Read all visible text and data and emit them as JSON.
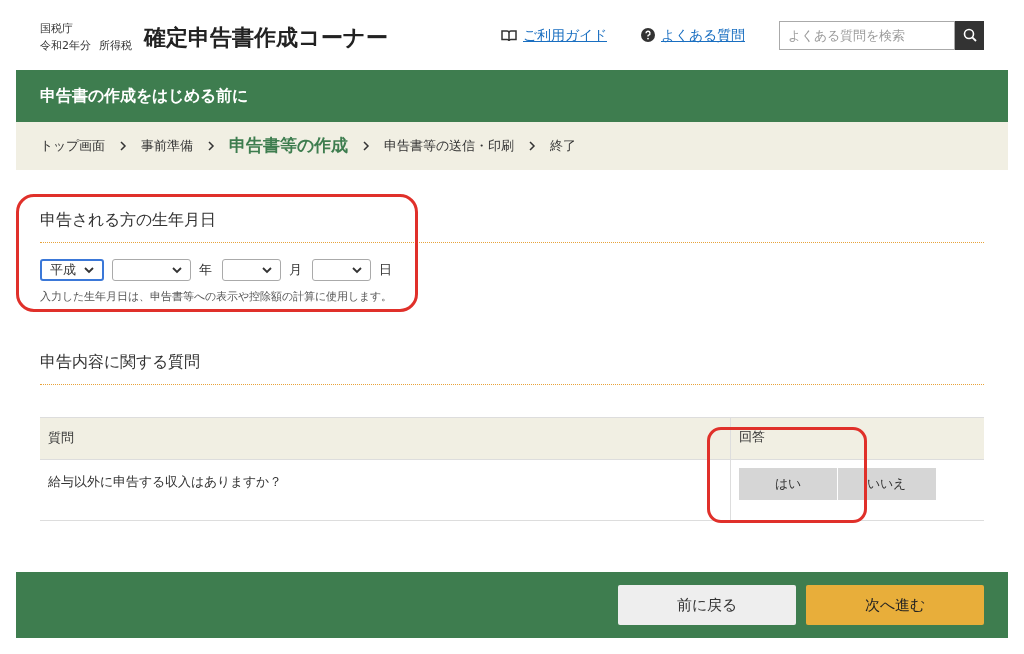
{
  "header": {
    "agency": "国税庁",
    "year": "令和2年分",
    "tax": "所得税",
    "title": "確定申告書作成コーナー",
    "links": [
      {
        "kind": "guide",
        "label": "ご利用ガイド"
      },
      {
        "kind": "faq",
        "label": "よくある質問"
      }
    ],
    "search": {
      "placeholder": "よくある質問を検索"
    }
  },
  "page_title": "申告書の作成をはじめる前に",
  "steps": [
    {
      "label": "トップ画面",
      "selected": false
    },
    {
      "label": "事前準備",
      "selected": false
    },
    {
      "label": "申告書等の作成",
      "selected": true
    },
    {
      "label": "申告書等の送信・印刷",
      "selected": false
    },
    {
      "label": "終了",
      "selected": false
    }
  ],
  "birth_date": {
    "heading": "申告される方の生年月日",
    "highlighted": true,
    "fields": [
      {
        "value": "平成",
        "focused": true
      },
      {
        "unit": "年",
        "focused": false
      },
      {
        "unit": "月",
        "focused": false
      },
      {
        "unit": "日",
        "focused": false
      }
    ],
    "note": "入力した生年月日は、申告書等への表示や控除額の計算に使用します。"
  },
  "questions": {
    "heading": "申告内容に関する質問",
    "columns": [
      "質問",
      "回答"
    ],
    "answer_highlighted": true,
    "rows": [
      {
        "question": "給与以外に申告する収入はありますか？",
        "answers": [
          "はい",
          "いいえ"
        ]
      }
    ]
  },
  "footer": {
    "buttons": [
      {
        "kind": "back",
        "label": "前に戻る"
      },
      {
        "kind": "next",
        "label": "次へ進む"
      }
    ]
  }
}
